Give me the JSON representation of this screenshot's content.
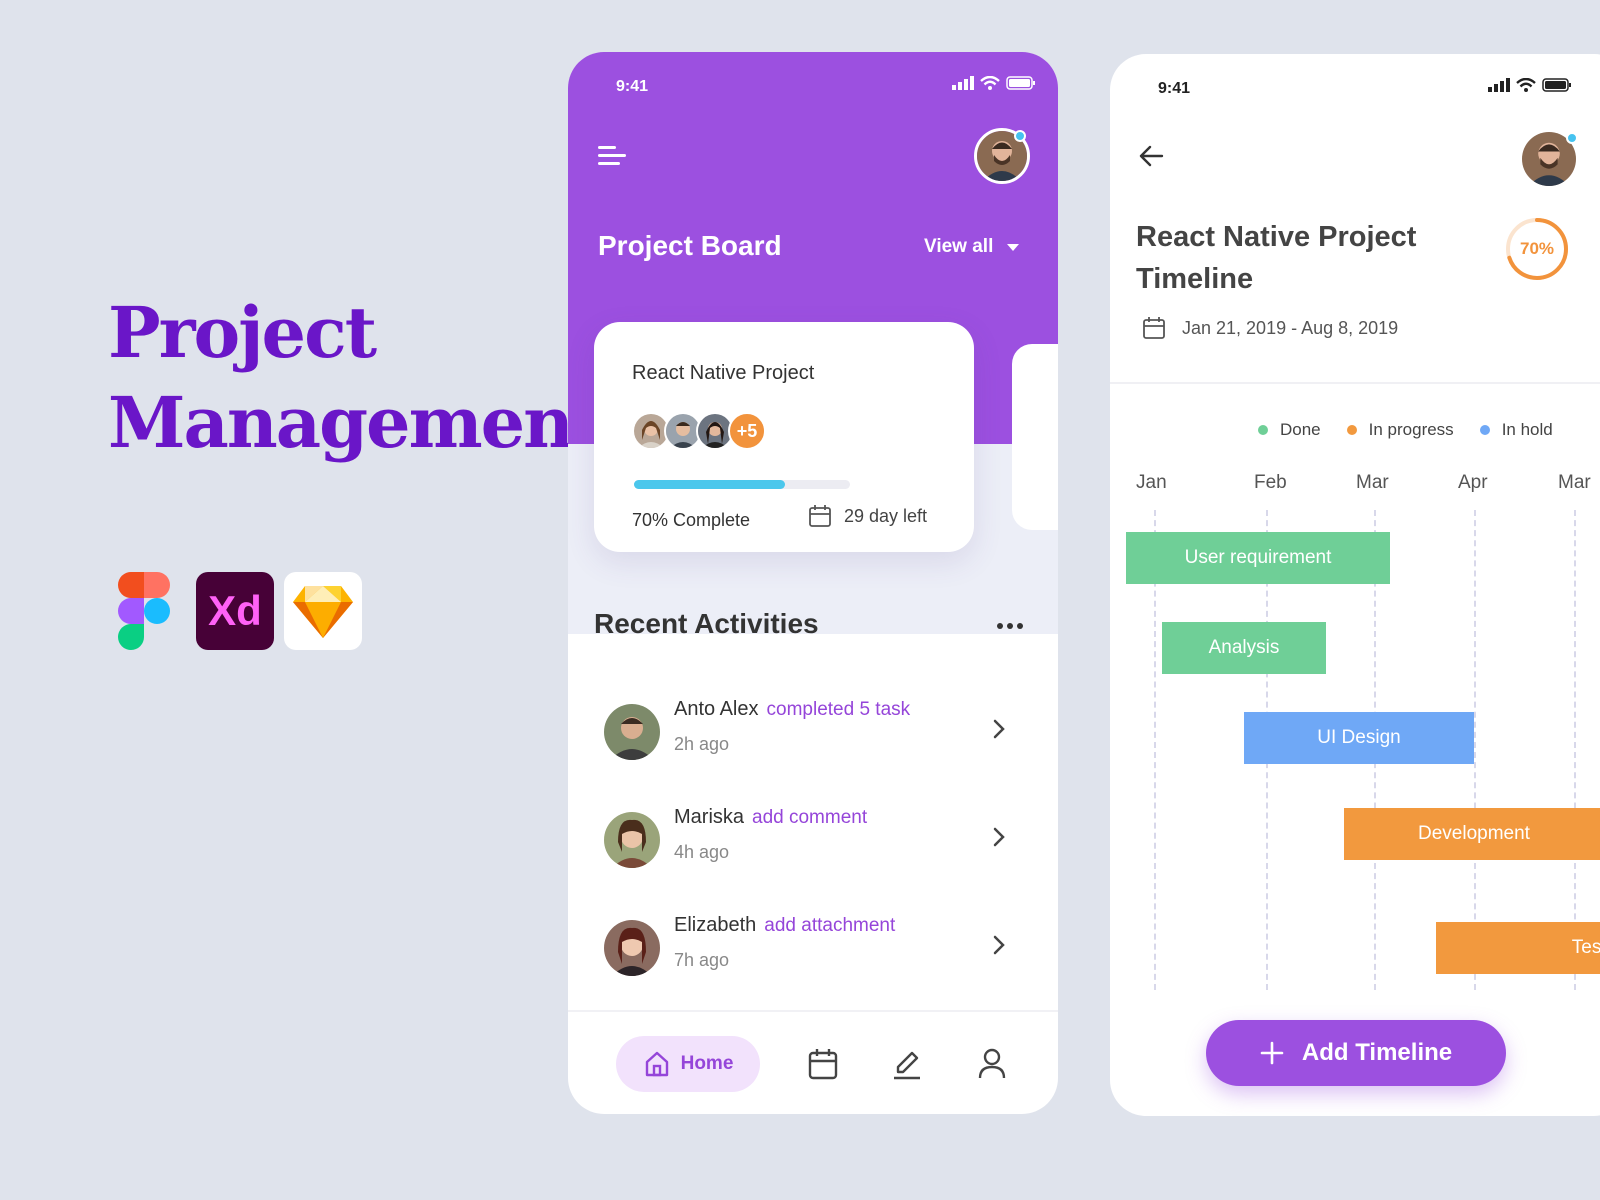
{
  "hero": {
    "title_line1": "Project",
    "title_line2": "Management",
    "tool_xd": "Xd"
  },
  "board": {
    "status_time": "9:41",
    "title": "Project Board",
    "view_all": "View all",
    "card": {
      "name": "React Native Project",
      "extra_members": "+5",
      "progress": 0.7,
      "complete_text": "70% Complete",
      "days_left": "29 day left"
    },
    "recent": {
      "title": "Recent Activities",
      "items": [
        {
          "name": "Anto Alex",
          "action": "completed 5 task",
          "when": "2h ago"
        },
        {
          "name": "Mariska",
          "action": "add comment",
          "when": "4h ago"
        },
        {
          "name": "Elizabeth",
          "action": "add attachment",
          "when": "7h ago"
        }
      ]
    },
    "nav": {
      "home": "Home"
    }
  },
  "timeline": {
    "status_time": "9:41",
    "title": "React Native Project Timeline",
    "percent_label": "70%",
    "percent": 0.7,
    "date_range": "Jan 21, 2019 - Aug 8, 2019",
    "legend": [
      {
        "label": "Done",
        "color": "#6fcf97"
      },
      {
        "label": "In progress",
        "color": "#f2993e"
      },
      {
        "label": "In hold",
        "color": "#6fa8f6"
      }
    ],
    "months": [
      "Jan",
      "Feb",
      "Mar",
      "Apr",
      "Mar"
    ],
    "tasks": [
      {
        "label": "User requirement",
        "status": "Done",
        "color": "#6fcf97"
      },
      {
        "label": "Analysis",
        "status": "Done",
        "color": "#6fcf97"
      },
      {
        "label": "UI Design",
        "status": "In hold",
        "color": "#6fa8f6"
      },
      {
        "label": "Development",
        "status": "In progress",
        "color": "#f2993e"
      },
      {
        "label": "Testing",
        "status": "In progress",
        "color": "#f2993e"
      }
    ],
    "add_button": "Add Timeline"
  },
  "colors": {
    "accent": "#9c50e0",
    "action_text": "#9545d9",
    "progress": "#4bc7ec",
    "orange": "#f2933c"
  }
}
